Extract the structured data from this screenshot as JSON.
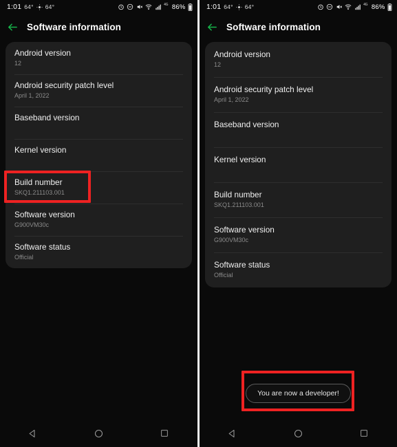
{
  "status_bar": {
    "time": "1:01",
    "temp_primary": "64°",
    "temp_secondary": "64°",
    "network_label": "4G",
    "battery_percent": "86%",
    "icons": [
      "alarm-icon",
      "do-not-disturb-icon",
      "mute-icon",
      "wifi-icon",
      "signal-icon",
      "battery-icon"
    ]
  },
  "app_bar": {
    "back_icon": "back-arrow-icon",
    "title": "Software information",
    "accent_color": "#16b44a"
  },
  "list": {
    "rows": [
      {
        "title": "Android version",
        "value": "12"
      },
      {
        "title": "Android security patch level",
        "value": "April 1, 2022"
      },
      {
        "title": "Baseband version",
        "value": ""
      },
      {
        "title": "Kernel version",
        "value": ""
      },
      {
        "title": "Build number",
        "value": "SKQ1.211103.001"
      },
      {
        "title": "Software version",
        "value": "G900VM30c"
      },
      {
        "title": "Software status",
        "value": "Official"
      }
    ]
  },
  "toast": {
    "message": "You are now a developer!"
  },
  "nav_bar": {
    "back_label": "back-nav-icon",
    "home_label": "home-nav-icon",
    "recents_label": "recents-nav-icon"
  },
  "annotations": {
    "highlight_color": "#ee2222",
    "left_target": "Build number",
    "right_target": "You are now a developer!"
  }
}
